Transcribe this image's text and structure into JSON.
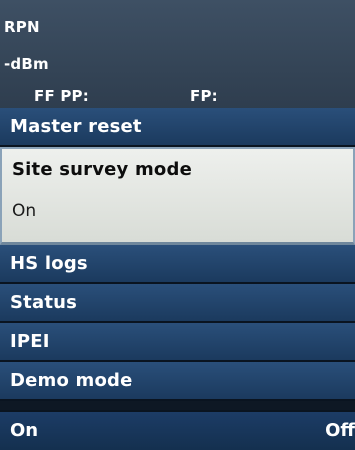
{
  "background": {
    "line1": "RPN",
    "line2": "-dBm",
    "line3a": "FF PP:",
    "line3b": "FP:"
  },
  "menu": {
    "items": [
      {
        "label": "Master reset"
      },
      {
        "label": "Site survey mode",
        "value": "On",
        "selected": true
      },
      {
        "label": "HS logs"
      },
      {
        "label": "Status"
      },
      {
        "label": "IPEI"
      },
      {
        "label": "Demo mode"
      }
    ]
  },
  "softkeys": {
    "left": "On",
    "right": "Off"
  },
  "colors": {
    "menu_bg": "#1b3a5e",
    "selected_bg": "#e6e8e4",
    "softkey_bg": "#14304f"
  }
}
